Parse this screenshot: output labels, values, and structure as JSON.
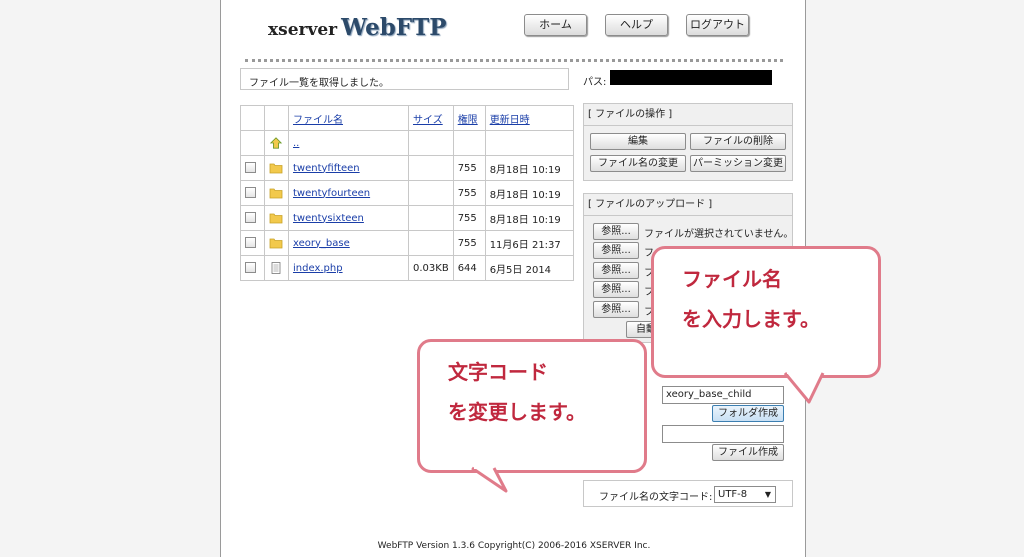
{
  "header": {
    "logo_part1": "xserver",
    "logo_part2": "WebFTP",
    "home_label": "ホーム",
    "help_label": "ヘルプ",
    "logout_label": "ログアウト"
  },
  "status_message": "ファイル一覧を取得しました。",
  "path_label": "パス:",
  "file_table": {
    "headers": [
      "ファイル名",
      "サイズ",
      "権限",
      "更新日時"
    ],
    "parent_link": "..",
    "rows": [
      {
        "name": "twentyfifteen",
        "size": "",
        "perm": "755",
        "date": "8月18日 10:19",
        "icon": "folder-icon"
      },
      {
        "name": "twentyfourteen",
        "size": "",
        "perm": "755",
        "date": "8月18日 10:19",
        "icon": "folder-icon"
      },
      {
        "name": "twentysixteen",
        "size": "",
        "perm": "755",
        "date": "8月18日 10:19",
        "icon": "folder-icon"
      },
      {
        "name": "xeory_base",
        "size": "",
        "perm": "755",
        "date": "11月6日 21:37",
        "icon": "folder-icon"
      },
      {
        "name": "index.php",
        "size": "0.03KB",
        "perm": "644",
        "date": "6月5日 2014",
        "icon": "file-icon"
      }
    ]
  },
  "file_ops": {
    "title": "[ ファイルの操作 ]",
    "edit": "編集",
    "delete": "ファイルの削除",
    "rename": "ファイル名の変更",
    "permission": "パーミッション変更"
  },
  "upload": {
    "title": "[ ファイルのアップロード ]",
    "browse": "参照...",
    "no_file": "ファイルが選択されていません。",
    "partial_text": "フ",
    "auto_label": "自動"
  },
  "folder_create": {
    "input_value": "xeory_base_child",
    "button": "フォルダ作成"
  },
  "file_create": {
    "input_value": "",
    "button": "ファイル作成"
  },
  "encoding": {
    "label": "ファイル名の文字コード:",
    "value": "UTF-8"
  },
  "footer": "WebFTP Version 1.3.6 Copyright(C) 2006-2016 XSERVER Inc.",
  "callouts": {
    "filename_line1": "ファイル名",
    "filename_line2": "を入力します。",
    "encoding_line1": "文字コード",
    "encoding_line2": "を変更します。"
  },
  "colors": {
    "callout_border": "#e07b8a",
    "callout_text": "#c0283e",
    "link": "#1a3ea8",
    "folder": "#f2c94c"
  }
}
